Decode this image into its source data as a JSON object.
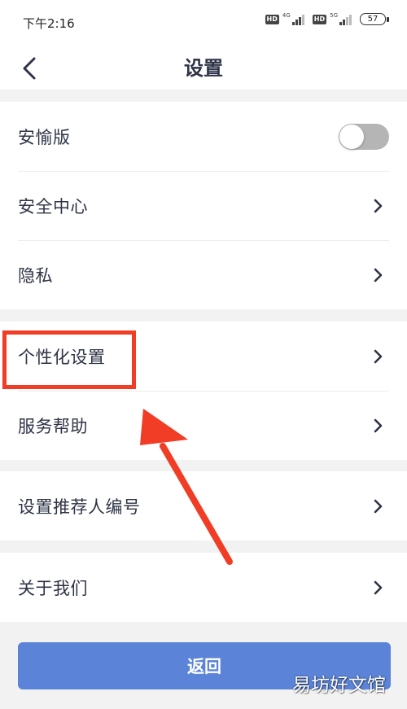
{
  "status_bar": {
    "time": "下午2:16",
    "hd1": "HD",
    "net1": "4G",
    "hd2": "HD",
    "net2": "5G",
    "battery": "57"
  },
  "header": {
    "title": "设置",
    "back_icon": "chevron-left-icon"
  },
  "settings": {
    "group1": [
      {
        "label": "安愉版",
        "control": "toggle",
        "toggle_on": false
      },
      {
        "label": "安全中心",
        "control": "chevron"
      },
      {
        "label": "隐私",
        "control": "chevron"
      }
    ],
    "group2": [
      {
        "label": "个性化设置",
        "control": "chevron",
        "highlighted": true
      },
      {
        "label": "服务帮助",
        "control": "chevron"
      }
    ],
    "group3": [
      {
        "label": "设置推荐人编号",
        "control": "chevron"
      }
    ],
    "group4": [
      {
        "label": "关于我们",
        "control": "chevron"
      }
    ]
  },
  "footer": {
    "return_label": "返回"
  },
  "watermark": "易坊好文馆",
  "colors": {
    "accent_button": "#5b84d8",
    "annotation_red": "#f13c26",
    "toggle_off": "#b5b5b5",
    "page_bg": "#f2f2f2"
  }
}
